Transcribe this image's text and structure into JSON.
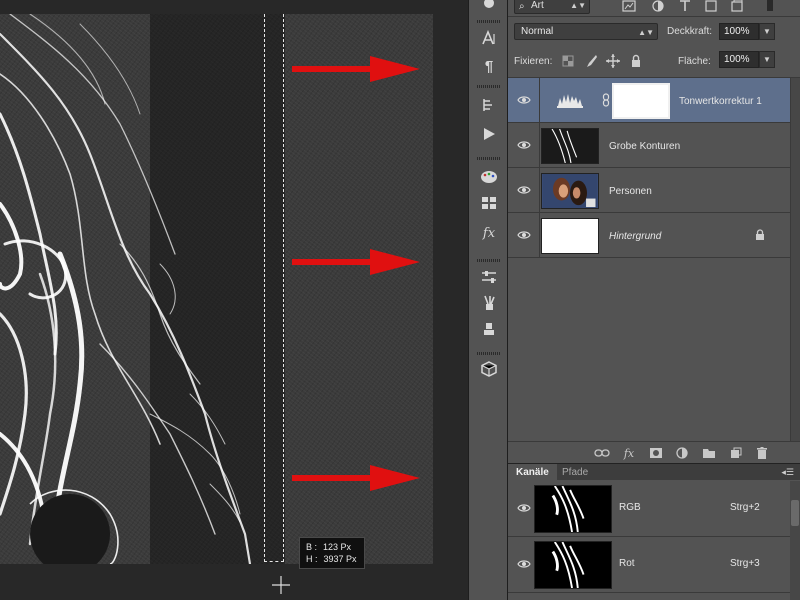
{
  "layers_panel": {
    "filter": {
      "kind_label": "Art"
    },
    "blend_mode": "Normal",
    "opacity_label": "Deckkraft:",
    "opacity_value": "100%",
    "lock_label": "Fixieren:",
    "fill_label": "Fläche:",
    "fill_value": "100%",
    "layers": [
      {
        "name": "Tonwertkorrektur 1",
        "selected": true
      },
      {
        "name": "Grobe Konturen",
        "selected": false
      },
      {
        "name": "Personen",
        "selected": false
      },
      {
        "name": "Hintergrund",
        "selected": false,
        "locked": true
      }
    ]
  },
  "channels_panel": {
    "tabs": [
      {
        "label": "Kanäle",
        "active": true
      },
      {
        "label": "Pfade",
        "active": false
      }
    ],
    "channels": [
      {
        "name": "RGB",
        "shortcut": "Strg+2"
      },
      {
        "name": "Rot",
        "shortcut": "Strg+3"
      }
    ]
  },
  "canvas": {
    "tooltip": {
      "width_label": "B :",
      "width_value": "123 Px",
      "height_label": "H :",
      "height_value": "3937 Px"
    }
  },
  "colors": {
    "selection_highlight": "#5e6f8c",
    "arrow": "#e01010",
    "panel_bg": "#535353"
  },
  "icons": {
    "tool_strip": [
      "history-brush-icon",
      "character-icon",
      "paragraph-icon",
      "history-icon",
      "actions-play-icon",
      "swatches-icon",
      "styles-icon",
      "fx-icon",
      "adjustments-icon",
      "brush-presets-icon",
      "clone-source-icon",
      "3d-icon"
    ],
    "layers_footer": [
      "link-icon",
      "fx-icon",
      "mask-icon",
      "adjustment-icon",
      "folder-icon",
      "new-layer-icon",
      "trash-icon"
    ]
  }
}
